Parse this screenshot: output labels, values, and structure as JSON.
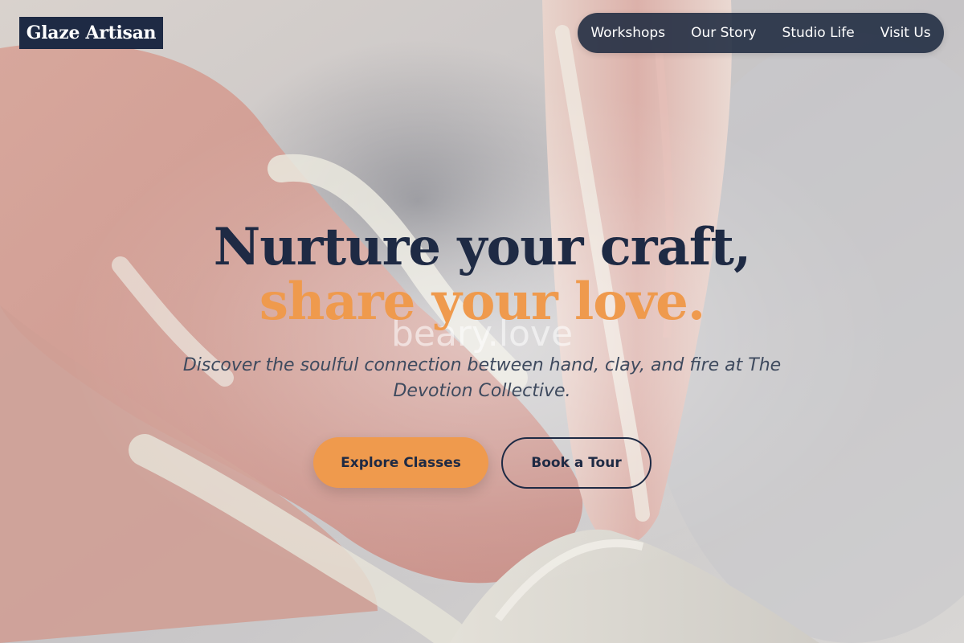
{
  "brand": {
    "logo_text": "Glaze Artisan"
  },
  "nav": {
    "items": [
      {
        "label": "Workshops"
      },
      {
        "label": "Our Story"
      },
      {
        "label": "Studio Life"
      },
      {
        "label": "Visit Us"
      }
    ]
  },
  "hero": {
    "headline_line1": "Nurture your craft,",
    "headline_line2": "share your love.",
    "ghost_text": "beary.love",
    "subtitle": "Discover the soulful connection between hand, clay, and fire at The Devotion Collective.",
    "primary_cta": "Explore Classes",
    "secondary_cta": "Book a Tour",
    "background_image": "pottery-wheel-hands-photo"
  },
  "colors": {
    "navy": "#1e2a44",
    "accent_orange": "#ef9a4d",
    "subtitle_gray": "#3e4a5e"
  }
}
